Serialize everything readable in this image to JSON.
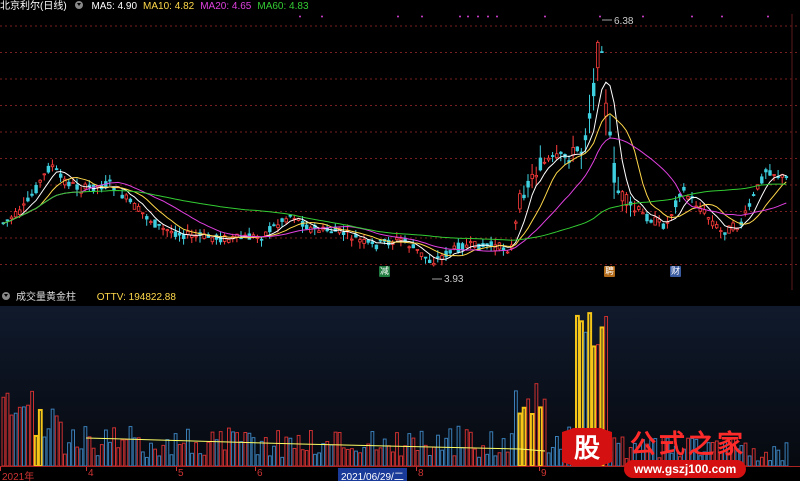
{
  "header": {
    "stock_name": "北京利尔(日线)",
    "ma": [
      {
        "label": "MA5: 4.90",
        "color": "#ffffff"
      },
      {
        "label": "MA10: 4.82",
        "color": "#ffd84a"
      },
      {
        "label": "MA20: 4.65",
        "color": "#e040e0"
      },
      {
        "label": "MA60: 4.83",
        "color": "#33cc33"
      }
    ]
  },
  "price_annotations": {
    "high": "6.38",
    "low": "3.93"
  },
  "badges": [
    {
      "text": "减",
      "bg": "#1f7a3f",
      "fg": "#ffffff"
    },
    {
      "text": "聘",
      "bg": "#b06a1a",
      "fg": "#ffffff"
    },
    {
      "text": "财",
      "bg": "#3a5aa0",
      "fg": "#ffffff"
    }
  ],
  "indicator": {
    "name": "成交量黄金柱",
    "ottv_label": "OTTV: 194822.88"
  },
  "time_axis": {
    "labels": [
      "2021年",
      "4",
      "5",
      "6",
      "8",
      "9"
    ],
    "selected": "2021/06/29/二"
  },
  "watermark": {
    "logo_char": "股",
    "title": "公式之家",
    "url": "www.gszj100.com"
  },
  "colors": {
    "up": "#ff3c3c",
    "down": "#3fd0e0",
    "grid": "#7a1f1f",
    "gold": "#f5c518",
    "ottv_line": "#ffff66"
  }
}
